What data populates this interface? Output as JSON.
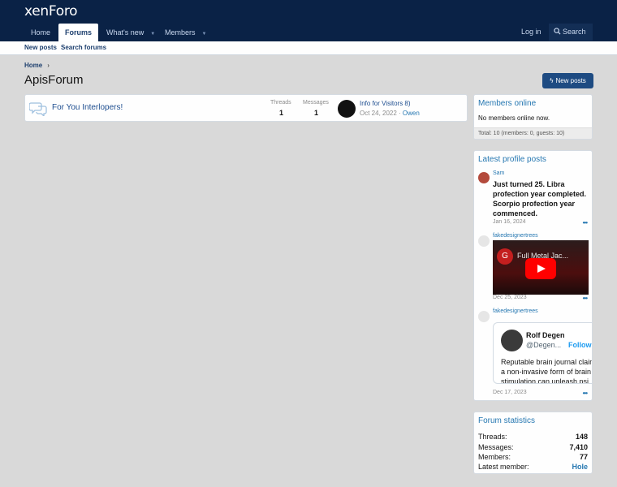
{
  "header": {
    "logo": "xenForo",
    "nav": [
      {
        "label": "Home"
      },
      {
        "label": "Forums"
      },
      {
        "label": "What's new"
      },
      {
        "label": "Members"
      }
    ],
    "login": "Log in",
    "search": "Search"
  },
  "subnav": {
    "new_posts": "New posts",
    "search_forums": "Search forums"
  },
  "breadcrumb": {
    "home": "Home"
  },
  "page": {
    "title": "ApisForum",
    "new_posts_button": "New posts"
  },
  "forum_node": {
    "title": "For You Interlopers!",
    "threads_label": "Threads",
    "threads": "1",
    "messages_label": "Messages",
    "messages": "1",
    "latest_title": "Info for Visitors 8)",
    "latest_date": "Oct 24, 2022",
    "latest_user": "Owen"
  },
  "members_online": {
    "title": "Members online",
    "status": "No members online now.",
    "total": "Total: 10 (members: 0, guests: 10)"
  },
  "profile_posts": {
    "title": "Latest profile posts",
    "posts": [
      {
        "user": "Sam",
        "text": "Just turned 25. Libra profection year completed. Scorpio profection year commenced.",
        "date": "Jan 16, 2024"
      },
      {
        "user": "fakedesignertrees",
        "video_channel": "G",
        "video_title": "Full Metal Jac...",
        "date": "Dec 25, 2023"
      },
      {
        "user": "fakedesignertrees",
        "tweet_name": "Rolf Degen",
        "tweet_handle": "@Degen...",
        "tweet_follow": "Follow",
        "tweet_text": "Reputable brain journal claim a non-invasive form of brain stimulation can unleash psi",
        "date": "Dec 17, 2023"
      }
    ],
    "more": "•••"
  },
  "forum_stats": {
    "title": "Forum statistics",
    "threads_label": "Threads:",
    "threads": "148",
    "messages_label": "Messages:",
    "messages": "7,410",
    "members_label": "Members:",
    "members": "77",
    "latest_member_label": "Latest member:",
    "latest_member": "Hole"
  }
}
